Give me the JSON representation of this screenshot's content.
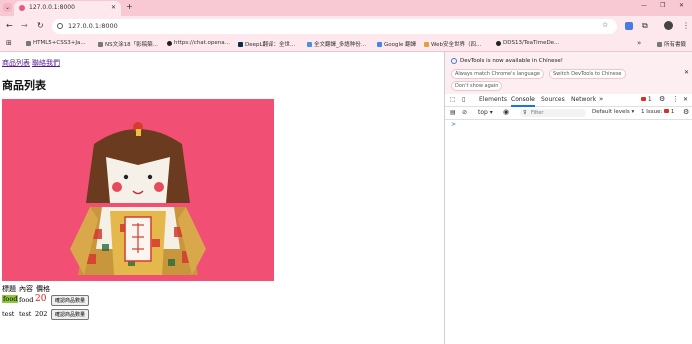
{
  "browser": {
    "tab": {
      "title": "127.0.0.1:8000"
    },
    "url": "127.0.0.1:8000",
    "bookmarks": [
      {
        "label": "HTML5+CSS3+Ja...",
        "color": "#f0c050"
      },
      {
        "label": "NS文涂18「影稿築...",
        "color": "#9a9a9a"
      },
      {
        "label": "https://chat.opena...",
        "color": "#202020"
      },
      {
        "label": "DeepL翻译：全世...",
        "color": "#0f2b46"
      },
      {
        "label": "全文翻譯_多語种份...",
        "color": "#4a8fe7"
      },
      {
        "label": "Google 翻譯",
        "color": "#4285f4"
      },
      {
        "label": "Web安全世界（四...",
        "color": "#e0a040"
      },
      {
        "label": "DDS13/TeaTimeDe...",
        "color": "#222222"
      }
    ],
    "all_bookmarks": "所有書籤"
  },
  "page": {
    "nav": [
      "商品列表",
      "聯絡我們"
    ],
    "heading": "商品列表",
    "image_alt_colors": {
      "background": "#f24f75"
    },
    "table_headers": [
      "標題",
      "內容",
      "價格"
    ],
    "rows": [
      {
        "title": "food",
        "content": "food",
        "price": "20",
        "button": "確認商品數量"
      },
      {
        "title": "test",
        "content": "test",
        "price": "202",
        "button": "確認商品數量"
      }
    ]
  },
  "devtools": {
    "notice": "DevTools is now available in Chinese!",
    "btn_match": "Always match Chrome's language",
    "btn_switch": "Switch DevTools to Chinese",
    "btn_dont": "Don't show again",
    "tabs": [
      "Elements",
      "Console",
      "Sources",
      "Network"
    ],
    "active_tab": "Console",
    "badge_count": "1",
    "context": "top",
    "filter_placeholder": "Filter",
    "levels": "Default levels",
    "issues": "1 Issue:",
    "issues_count": "1",
    "prompt": ">"
  }
}
